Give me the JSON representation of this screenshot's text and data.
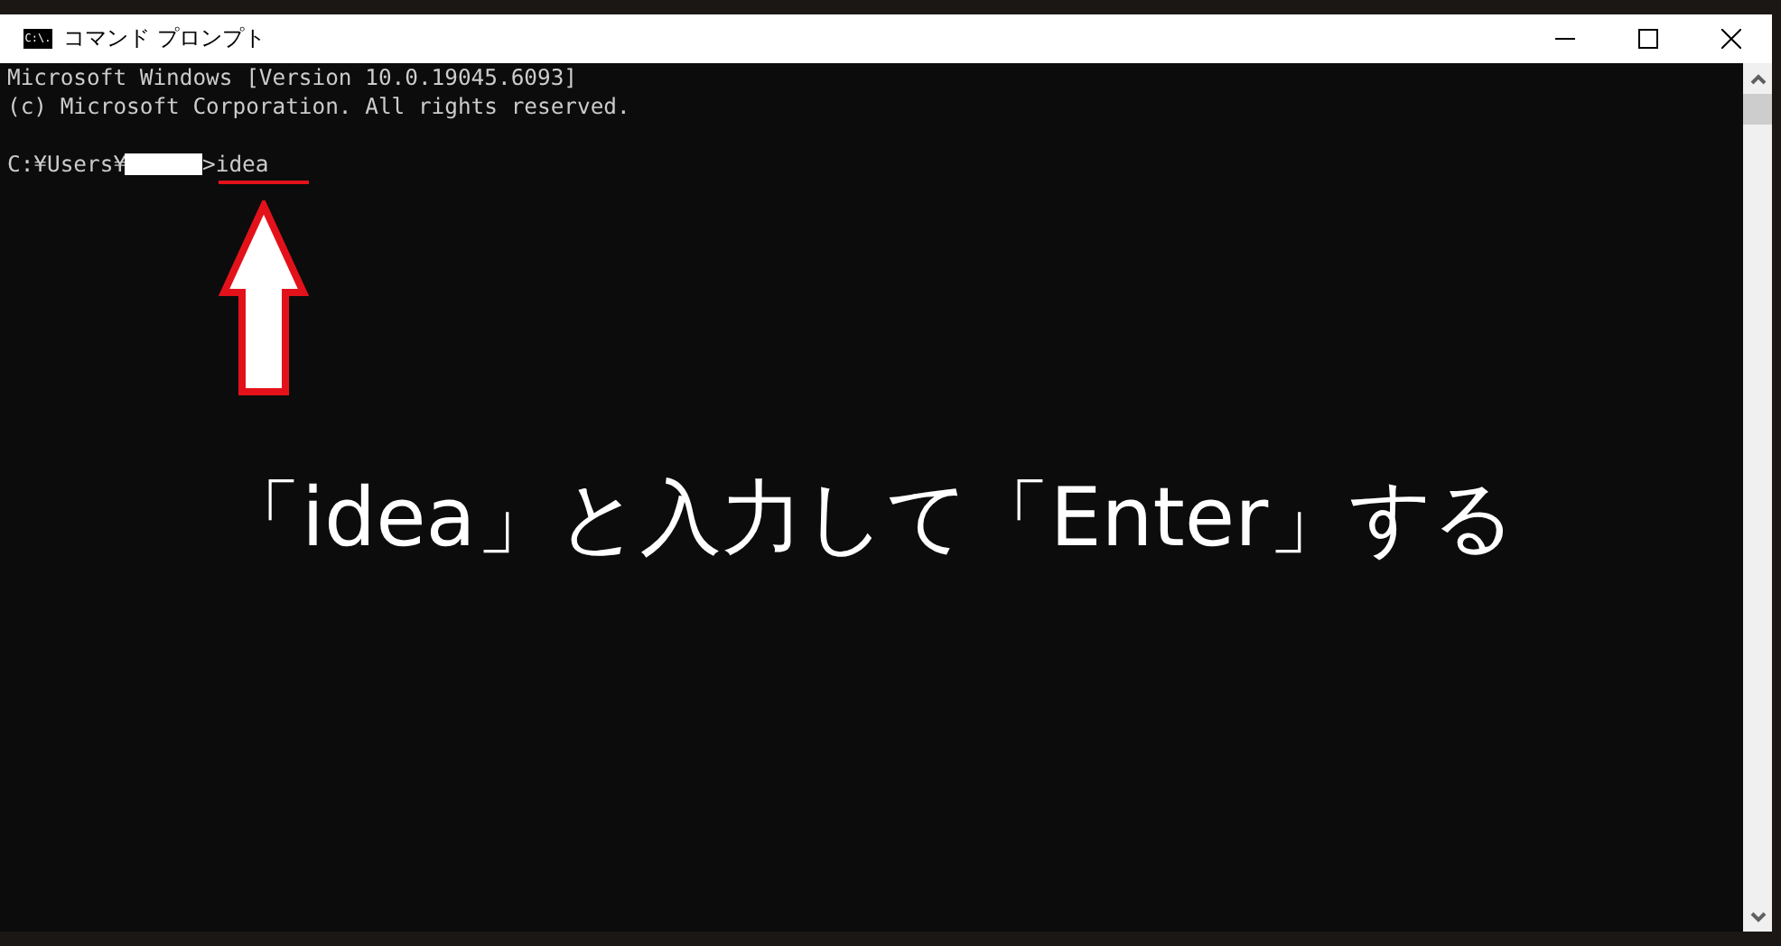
{
  "window": {
    "title": "コマンド プロンプト",
    "icon_text": "C:\\."
  },
  "console_lines": [
    "Microsoft Windows [Version 10.0.19045.6093]",
    "(c) Microsoft Corporation. All rights reserved."
  ],
  "prompt": {
    "prefix": "C:¥Users¥",
    "command": ">idea"
  },
  "annotation": "「idea」と入力して「Enter」する"
}
